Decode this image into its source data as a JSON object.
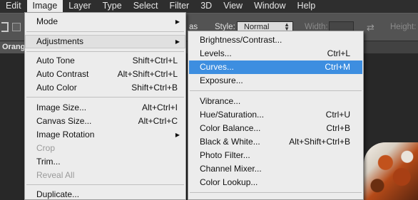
{
  "menubar": [
    "Edit",
    "Image",
    "Layer",
    "Type",
    "Select",
    "Filter",
    "3D",
    "View",
    "Window",
    "Help"
  ],
  "options": {
    "as_fragment": "as",
    "style_label": "Style:",
    "style_value": "Normal",
    "width_label": "Width:",
    "height_label": "Height:"
  },
  "document_tab": "Orang",
  "image_menu": {
    "items": [
      {
        "label": "Mode",
        "shortcut": "",
        "submenu": true,
        "disabled": false
      },
      {
        "label": "Adjustments",
        "shortcut": "",
        "submenu": true,
        "disabled": false
      },
      {
        "label": "Auto Tone",
        "shortcut": "Shift+Ctrl+L",
        "submenu": false,
        "disabled": false
      },
      {
        "label": "Auto Contrast",
        "shortcut": "Alt+Shift+Ctrl+L",
        "submenu": false,
        "disabled": false
      },
      {
        "label": "Auto Color",
        "shortcut": "Shift+Ctrl+B",
        "submenu": false,
        "disabled": false
      },
      {
        "label": "Image Size...",
        "shortcut": "Alt+Ctrl+I",
        "submenu": false,
        "disabled": false
      },
      {
        "label": "Canvas Size...",
        "shortcut": "Alt+Ctrl+C",
        "submenu": false,
        "disabled": false
      },
      {
        "label": "Image Rotation",
        "shortcut": "",
        "submenu": true,
        "disabled": false
      },
      {
        "label": "Crop",
        "shortcut": "",
        "submenu": false,
        "disabled": true
      },
      {
        "label": "Trim...",
        "shortcut": "",
        "submenu": false,
        "disabled": false
      },
      {
        "label": "Reveal All",
        "shortcut": "",
        "submenu": false,
        "disabled": true
      },
      {
        "label": "Duplicate...",
        "shortcut": "",
        "submenu": false,
        "disabled": false
      }
    ]
  },
  "adjustments_menu": {
    "items": [
      {
        "label": "Brightness/Contrast...",
        "shortcut": ""
      },
      {
        "label": "Levels...",
        "shortcut": "Ctrl+L"
      },
      {
        "label": "Curves...",
        "shortcut": "Ctrl+M"
      },
      {
        "label": "Exposure...",
        "shortcut": ""
      },
      {
        "label": "Vibrance...",
        "shortcut": ""
      },
      {
        "label": "Hue/Saturation...",
        "shortcut": "Ctrl+U"
      },
      {
        "label": "Color Balance...",
        "shortcut": "Ctrl+B"
      },
      {
        "label": "Black & White...",
        "shortcut": "Alt+Shift+Ctrl+B"
      },
      {
        "label": "Photo Filter...",
        "shortcut": ""
      },
      {
        "label": "Channel Mixer...",
        "shortcut": ""
      },
      {
        "label": "Color Lookup...",
        "shortcut": ""
      }
    ]
  },
  "colors": {
    "highlight": "#3d8ee0",
    "menu_bg": "#ececec",
    "menubar_bg": "#2e2e2e",
    "options_bg": "#535353"
  }
}
